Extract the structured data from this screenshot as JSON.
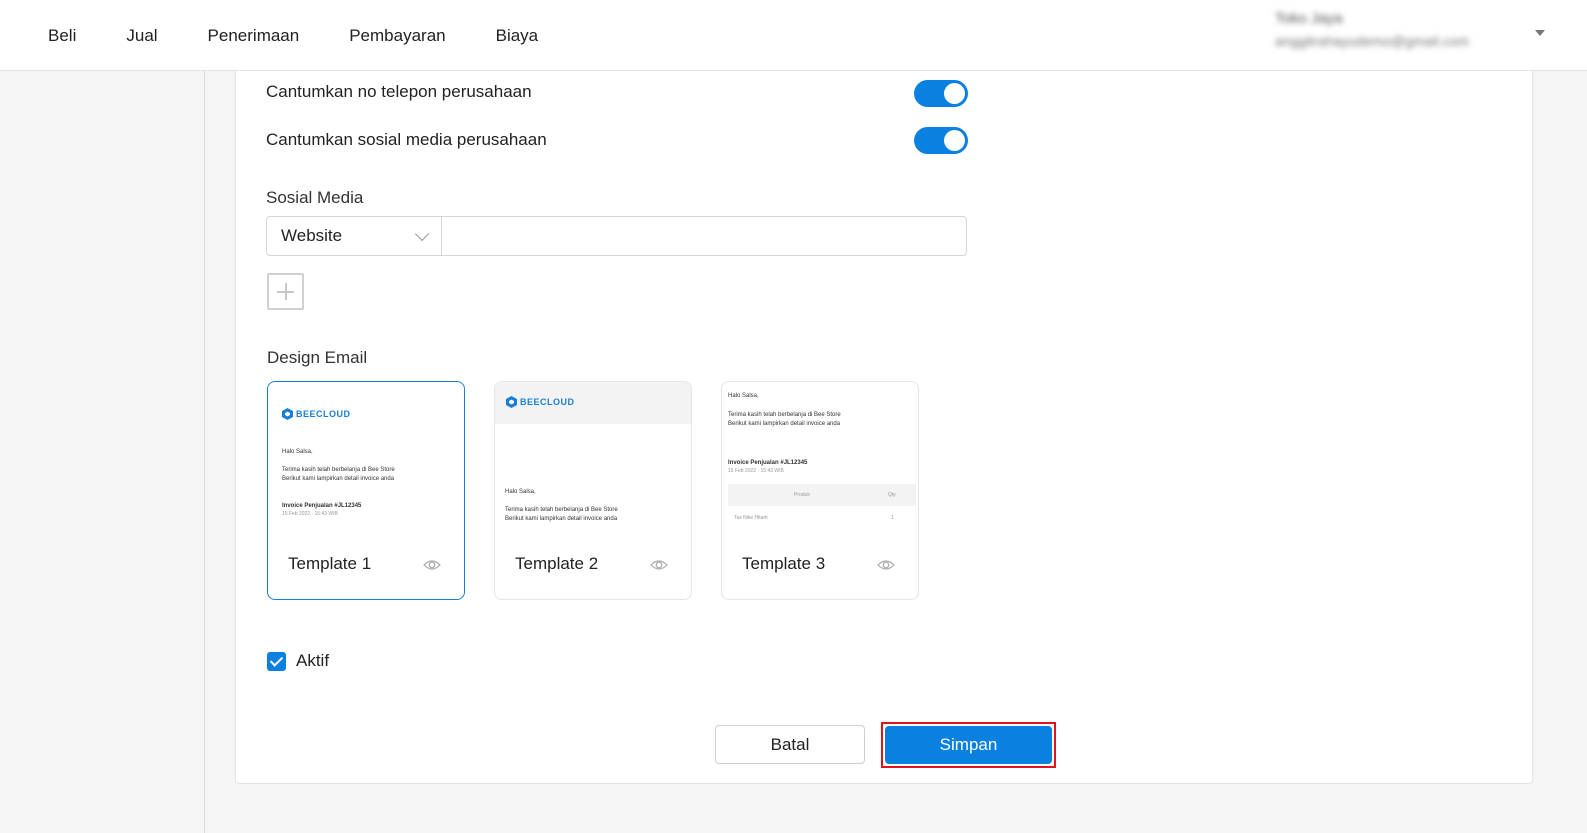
{
  "nav": {
    "items": [
      "Beli",
      "Jual",
      "Penerimaan",
      "Pembayaran",
      "Biaya"
    ]
  },
  "user": {
    "name": "Toko Jaya",
    "email": "anggitrahayudemo@gmail.com"
  },
  "settings": {
    "phone_label": "Cantumkan no telepon perusahaan",
    "phone_enabled": true,
    "social_label": "Cantumkan sosial media perusahaan",
    "social_enabled": true
  },
  "social_media": {
    "title": "Sosial Media",
    "selected_type": "Website",
    "value": ""
  },
  "design_email": {
    "title": "Design Email",
    "selected_template": "Template 1",
    "brand": "BEECLOUD",
    "greeting": "Halo Salsa,",
    "line1": "Terima kasih telah berbelanja di Bee Store",
    "line2": "Berikut kami lampirkan detail invoice anda",
    "invoice_title": "Invoice Penjualan #JL12345",
    "invoice_date": "15 Feb 2022 · 15:43 WIB",
    "table_headers": [
      "Produk",
      "Qty"
    ],
    "table_row": [
      "Tas Nike Hitam",
      "1"
    ],
    "templates": [
      {
        "name": "Template 1"
      },
      {
        "name": "Template 2"
      },
      {
        "name": "Template 3"
      }
    ]
  },
  "active": {
    "label": "Aktif",
    "checked": true
  },
  "actions": {
    "cancel_label": "Batal",
    "save_label": "Simpan"
  },
  "colors": {
    "accent": "#0a80e0",
    "highlight": "#e0141e"
  }
}
